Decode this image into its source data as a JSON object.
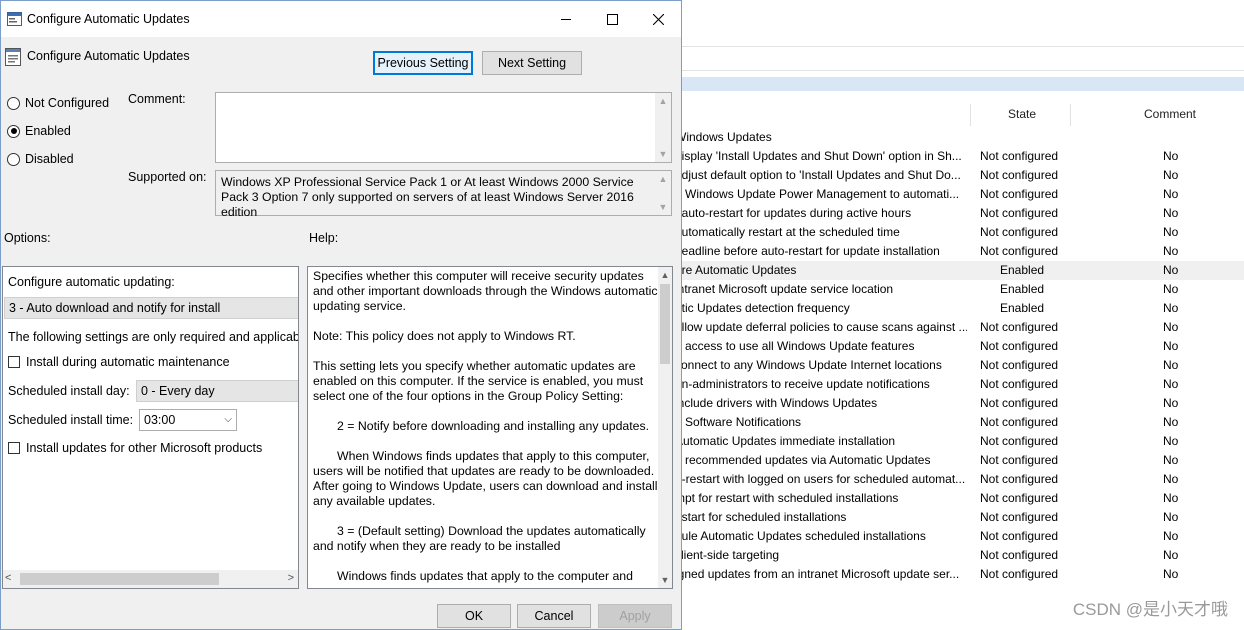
{
  "policy_list": {
    "col_state": "State",
    "col_comment": "Comment",
    "group_label": "Windows Updates",
    "rows": [
      {
        "name": "display 'Install Updates and Shut Down' option in Sh...",
        "state": "Not configured",
        "comment": "No"
      },
      {
        "name": "adjust default option to 'Install Updates and Shut Do...",
        "state": "Not configured",
        "comment": "No"
      },
      {
        "name": "g Windows Update Power Management to automati...",
        "state": "Not configured",
        "comment": "No"
      },
      {
        "name": "f auto-restart for updates during active hours",
        "state": "Not configured",
        "comment": "No"
      },
      {
        "name": "automatically restart at the scheduled time",
        "state": "Not configured",
        "comment": "No"
      },
      {
        "name": "deadline before auto-restart for update installation",
        "state": "Not configured",
        "comment": "No"
      },
      {
        "name": "ure Automatic Updates",
        "state": "Enabled",
        "comment": "No",
        "selected": true
      },
      {
        "name": "intranet Microsoft update service location",
        "state": "Enabled",
        "comment": "No"
      },
      {
        "name": "atic Updates detection frequency",
        "state": "Enabled",
        "comment": "No"
      },
      {
        "name": "allow update deferral policies to cause scans against ...",
        "state": "Not configured",
        "comment": "No"
      },
      {
        "name": "e access to use all Windows Update features",
        "state": "Not configured",
        "comment": "No"
      },
      {
        "name": "connect to any Windows Update Internet locations",
        "state": "Not configured",
        "comment": "No"
      },
      {
        "name": "on-administrators to receive update notifications",
        "state": "Not configured",
        "comment": "No"
      },
      {
        "name": "include drivers with Windows Updates",
        "state": "Not configured",
        "comment": "No"
      },
      {
        "name": "n Software Notifications",
        "state": "Not configured",
        "comment": "No"
      },
      {
        "name": "Automatic Updates immediate installation",
        "state": "Not configured",
        "comment": "No"
      },
      {
        "name": "n recommended updates via Automatic Updates",
        "state": "Not configured",
        "comment": "No"
      },
      {
        "name": "o-restart with logged on users for scheduled automat...",
        "state": "Not configured",
        "comment": "No"
      },
      {
        "name": "mpt for restart with scheduled installations",
        "state": "Not configured",
        "comment": "No"
      },
      {
        "name": "estart for scheduled installations",
        "state": "Not configured",
        "comment": "No"
      },
      {
        "name": "dule Automatic Updates scheduled installations",
        "state": "Not configured",
        "comment": "No"
      },
      {
        "name": "client-side targeting",
        "state": "Not configured",
        "comment": "No"
      },
      {
        "name": "igned updates from an intranet Microsoft update ser...",
        "state": "Not configured",
        "comment": "No"
      }
    ]
  },
  "watermark": "CSDN @是小天才哦",
  "dialog": {
    "window_title": "Configure Automatic Updates",
    "header_title": "Configure Automatic Updates",
    "prev_button": "Previous Setting",
    "next_button": "Next Setting",
    "radio_not_configured": "Not Configured",
    "radio_enabled": "Enabled",
    "radio_disabled": "Disabled",
    "selected_radio": "Enabled",
    "comment_label": "Comment:",
    "comment_value": "",
    "supported_label": "Supported on:",
    "supported_text": "Windows XP Professional Service Pack 1 or At least Windows 2000 Service Pack 3 Option 7 only supported on servers of at least Windows Server 2016 edition",
    "options_label": "Options:",
    "help_label": "Help:",
    "options": {
      "configure_label": "Configure automatic updating:",
      "configure_value": "3 - Auto download and notify for install",
      "following_text": "The following settings are only required and applicable",
      "install_maintenance": "Install during automatic maintenance",
      "install_day_label": "Scheduled install day:",
      "install_day_value": "0 - Every day",
      "install_time_label": "Scheduled install time:",
      "install_time_value": "03:00",
      "other_products": "Install updates for other Microsoft products"
    },
    "help": {
      "p1": "Specifies whether this computer will receive security updates and other important downloads through the Windows automatic updating service.",
      "p2": "Note: This policy does not apply to Windows RT.",
      "p3": "This setting lets you specify whether automatic updates are enabled on this computer. If the service is enabled, you must select one of the four options in the Group Policy Setting:",
      "p4": "2 = Notify before downloading and installing any updates.",
      "p5": "When Windows finds updates that apply to this computer, users will be notified that updates are ready to be downloaded. After going to Windows Update, users can download and install any available updates.",
      "p6": "3 = (Default setting) Download the updates automatically and notify when they are ready to be installed",
      "p7": "Windows finds updates that apply to the computer and"
    },
    "ok_button": "OK",
    "cancel_button": "Cancel",
    "apply_button": "Apply"
  }
}
